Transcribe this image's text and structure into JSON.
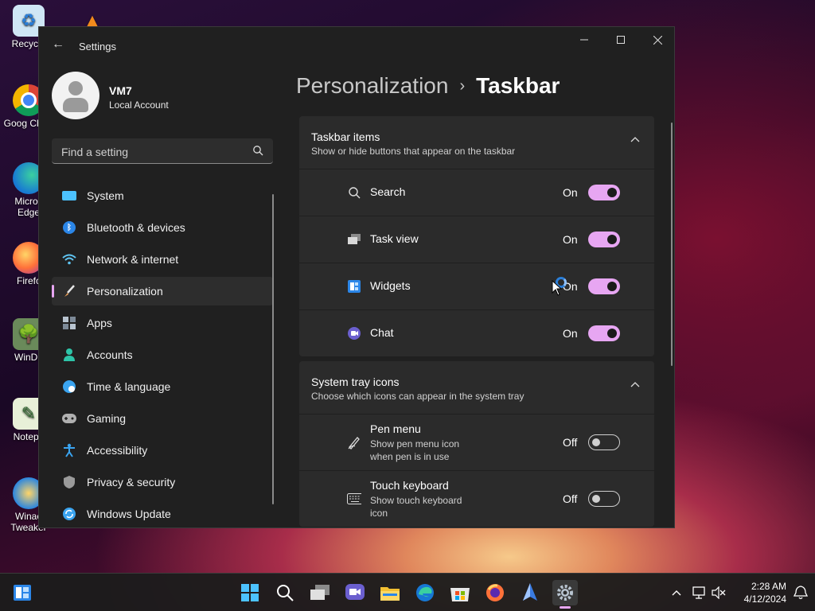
{
  "desktop": {
    "icons": [
      {
        "label": "Recycle",
        "icon": "recycle-bin-icon"
      },
      {
        "label": "Goog Chror",
        "icon": "chrome-icon"
      },
      {
        "label": "Micros Edge",
        "icon": "edge-icon"
      },
      {
        "label": "Firefc",
        "icon": "firefox-icon"
      },
      {
        "label": "WinDir",
        "icon": "windirstat-icon"
      },
      {
        "label": "Notepa",
        "icon": "notepad-icon"
      },
      {
        "label": "Winae Tweaker",
        "icon": "winaero-icon"
      }
    ]
  },
  "window": {
    "title": "Settings",
    "controls": {
      "minimize": "minimize-icon",
      "maximize": "maximize-icon",
      "close": "close-icon"
    }
  },
  "profile": {
    "name": "VM7",
    "account_type": "Local Account"
  },
  "search": {
    "placeholder": "Find a setting"
  },
  "nav": {
    "items": [
      {
        "label": "System",
        "icon": "system-icon",
        "color": "#4cc2ff"
      },
      {
        "label": "Bluetooth & devices",
        "icon": "bluetooth-icon",
        "color": "#2b86e8"
      },
      {
        "label": "Network & internet",
        "icon": "wifi-icon",
        "color": "#5fc4f2"
      },
      {
        "label": "Personalization",
        "icon": "brush-icon",
        "color": "#f0a35a",
        "active": true
      },
      {
        "label": "Apps",
        "icon": "apps-icon",
        "color": "#b8c4d0"
      },
      {
        "label": "Accounts",
        "icon": "accounts-icon",
        "color": "#2ec4a8"
      },
      {
        "label": "Time & language",
        "icon": "globe-clock-icon",
        "color": "#3aa4f0"
      },
      {
        "label": "Gaming",
        "icon": "gamepad-icon",
        "color": "#b0b0b0"
      },
      {
        "label": "Accessibility",
        "icon": "accessibility-icon",
        "color": "#3aa4f0"
      },
      {
        "label": "Privacy & security",
        "icon": "shield-icon",
        "color": "#9a9a9a"
      },
      {
        "label": "Windows Update",
        "icon": "update-icon",
        "color": "#3aa4f0"
      }
    ]
  },
  "breadcrumb": {
    "parent": "Personalization",
    "separator": "›",
    "current": "Taskbar"
  },
  "sections": {
    "taskbar_items": {
      "title": "Taskbar items",
      "subtitle": "Show or hide buttons that appear on the taskbar",
      "rows": [
        {
          "label": "Search",
          "state": "On",
          "on": true,
          "icon": "search-icon"
        },
        {
          "label": "Task view",
          "state": "On",
          "on": true,
          "icon": "task-view-icon"
        },
        {
          "label": "Widgets",
          "state": "On",
          "on": true,
          "icon": "widgets-icon"
        },
        {
          "label": "Chat",
          "state": "On",
          "on": true,
          "icon": "chat-icon"
        }
      ]
    },
    "system_tray": {
      "title": "System tray icons",
      "subtitle": "Choose which icons can appear in the system tray",
      "rows": [
        {
          "label": "Pen menu",
          "sub": "Show pen menu icon when pen is in use",
          "state": "Off",
          "on": false,
          "icon": "pen-icon"
        },
        {
          "label": "Touch keyboard",
          "sub": "Show touch keyboard icon",
          "state": "Off",
          "on": false,
          "icon": "keyboard-icon"
        }
      ]
    }
  },
  "taskbar": {
    "apps": [
      "windows-start-icon",
      "search-icon",
      "task-view-icon",
      "chat-icon",
      "file-explorer-icon",
      "edge-icon",
      "store-icon",
      "firefox-icon",
      "pen-app-icon",
      "settings-icon"
    ],
    "tray": [
      "chevron-up-icon",
      "network-icon",
      "volume-mute-icon",
      "notification-icon"
    ],
    "clock": {
      "time": "2:28 AM",
      "date": "4/12/2024"
    }
  },
  "colors": {
    "accent": "#e7a6f2",
    "window_bg": "#202020",
    "card_bg": "#2b2b2b"
  }
}
